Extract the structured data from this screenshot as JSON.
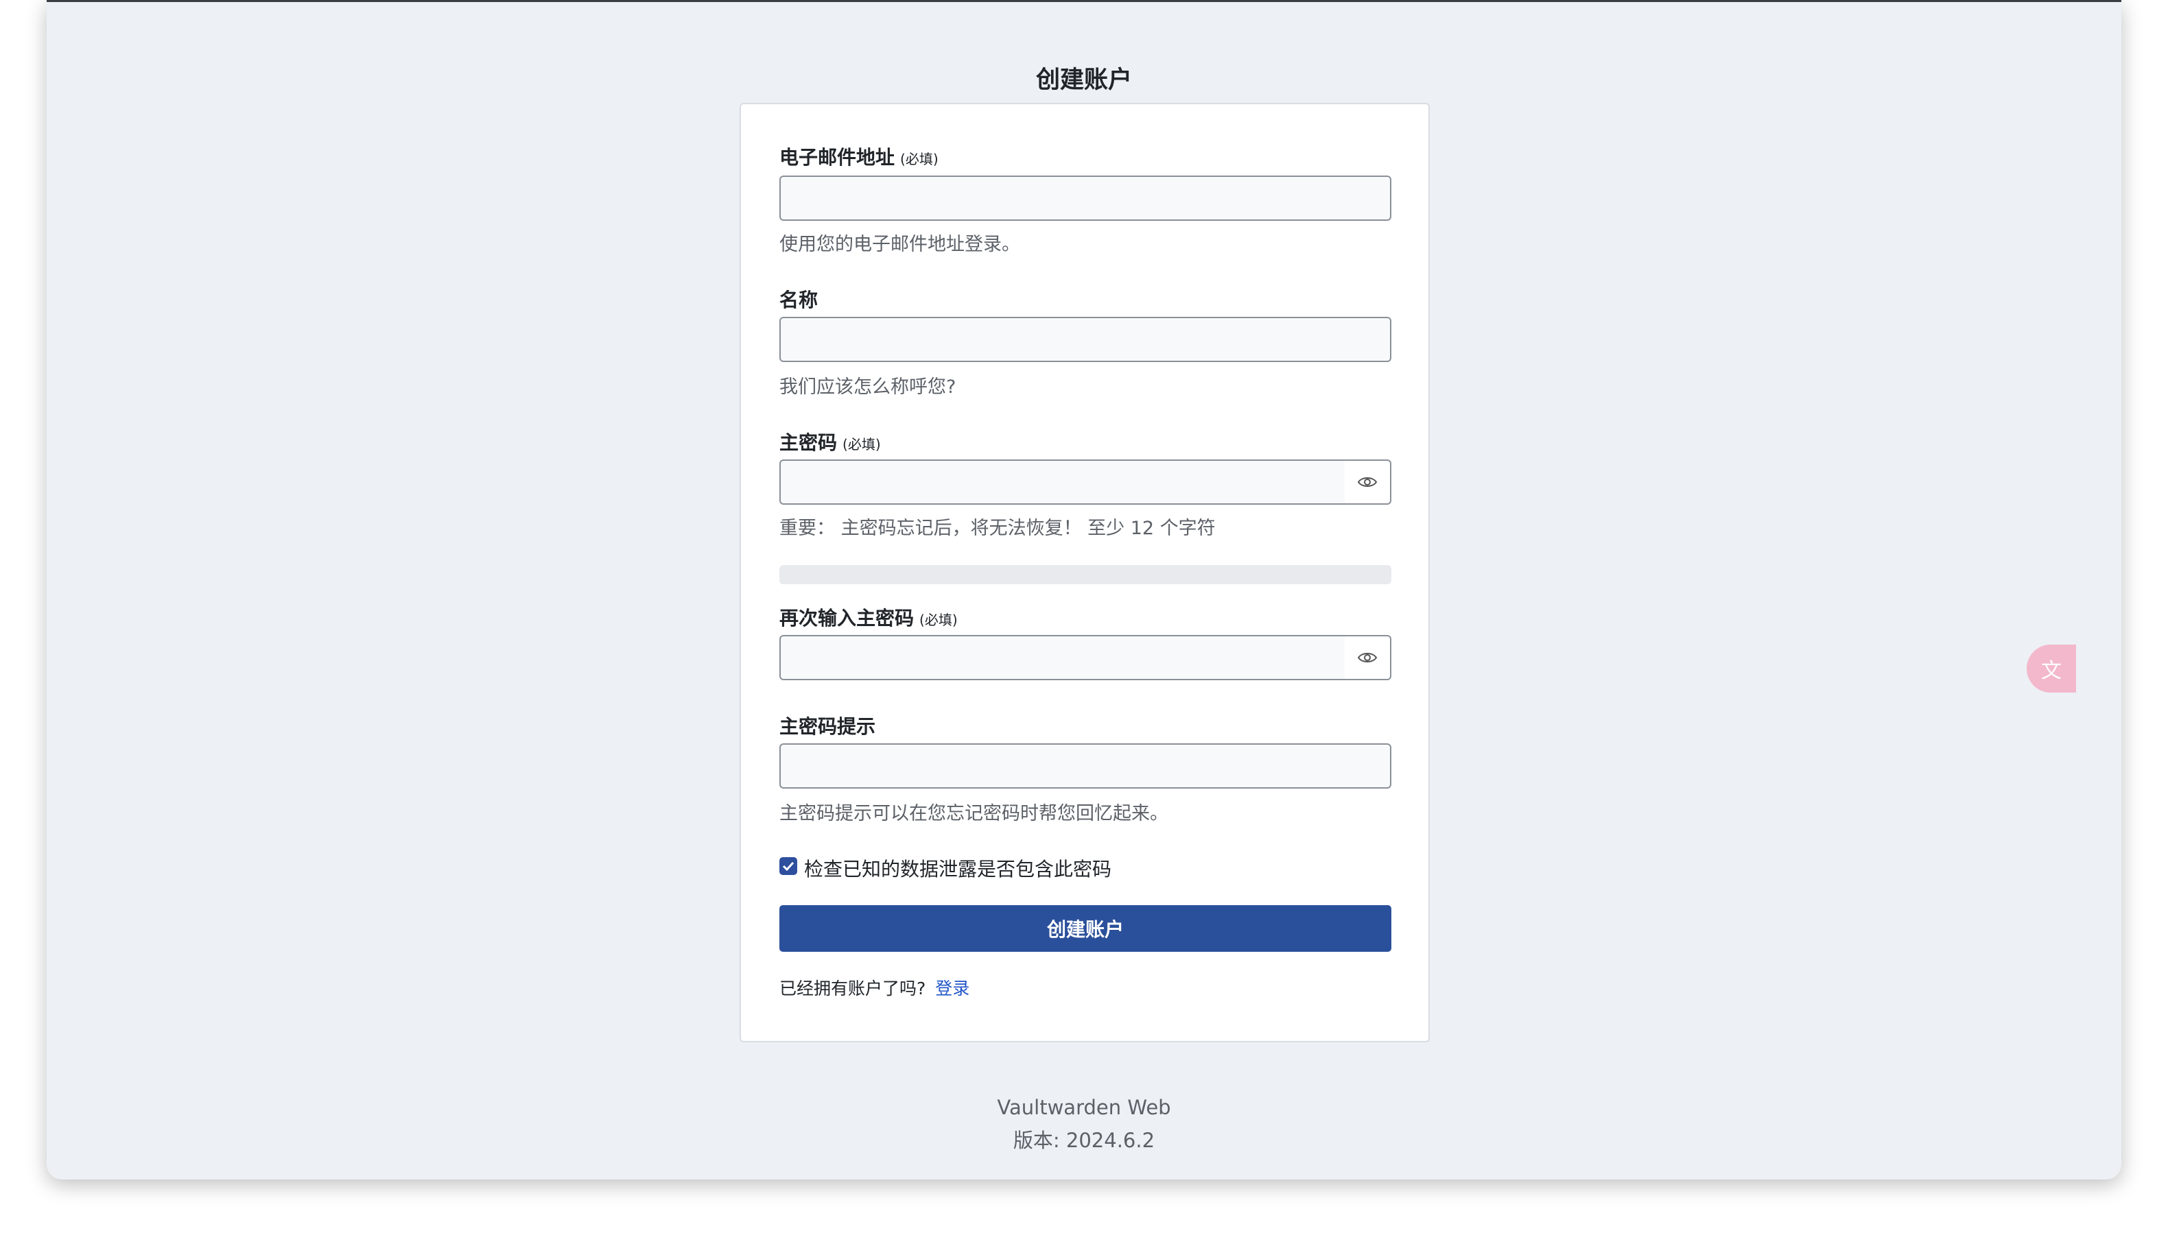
{
  "page": {
    "title": "创建账户"
  },
  "form": {
    "email": {
      "label": "电子邮件地址",
      "required": "(必填)",
      "value": "",
      "help": "使用您的电子邮件地址登录。"
    },
    "name": {
      "label": "名称",
      "value": "",
      "help": "我们应该怎么称呼您?"
    },
    "master_password": {
      "label": "主密码",
      "required": "(必填)",
      "value": "",
      "help": "重要： 主密码忘记后，将无法恢复！ 至少 12 个字符",
      "strength_percent": 0
    },
    "retype_password": {
      "label": "再次输入主密码",
      "required": "(必填)",
      "value": ""
    },
    "hint": {
      "label": "主密码提示",
      "value": "",
      "help": "主密码提示可以在您忘记密码时帮您回忆起来。"
    },
    "breach_check": {
      "label": "检查已知的数据泄露是否包含此密码",
      "checked": true
    },
    "submit_label": "创建账户",
    "login_prompt": "已经拥有账户了吗?",
    "login_link": "登录"
  },
  "footer": {
    "app_name": "Vaultwarden Web",
    "version": "版本: 2024.6.2"
  },
  "icons": {
    "show_password": "eye-icon",
    "translate": "translate-icon",
    "checkbox": "check-icon"
  },
  "colors": {
    "accent": "#2b509b",
    "link": "#2155c7",
    "background": "#edf0f4",
    "translate_badge": "#f3b8cb"
  }
}
